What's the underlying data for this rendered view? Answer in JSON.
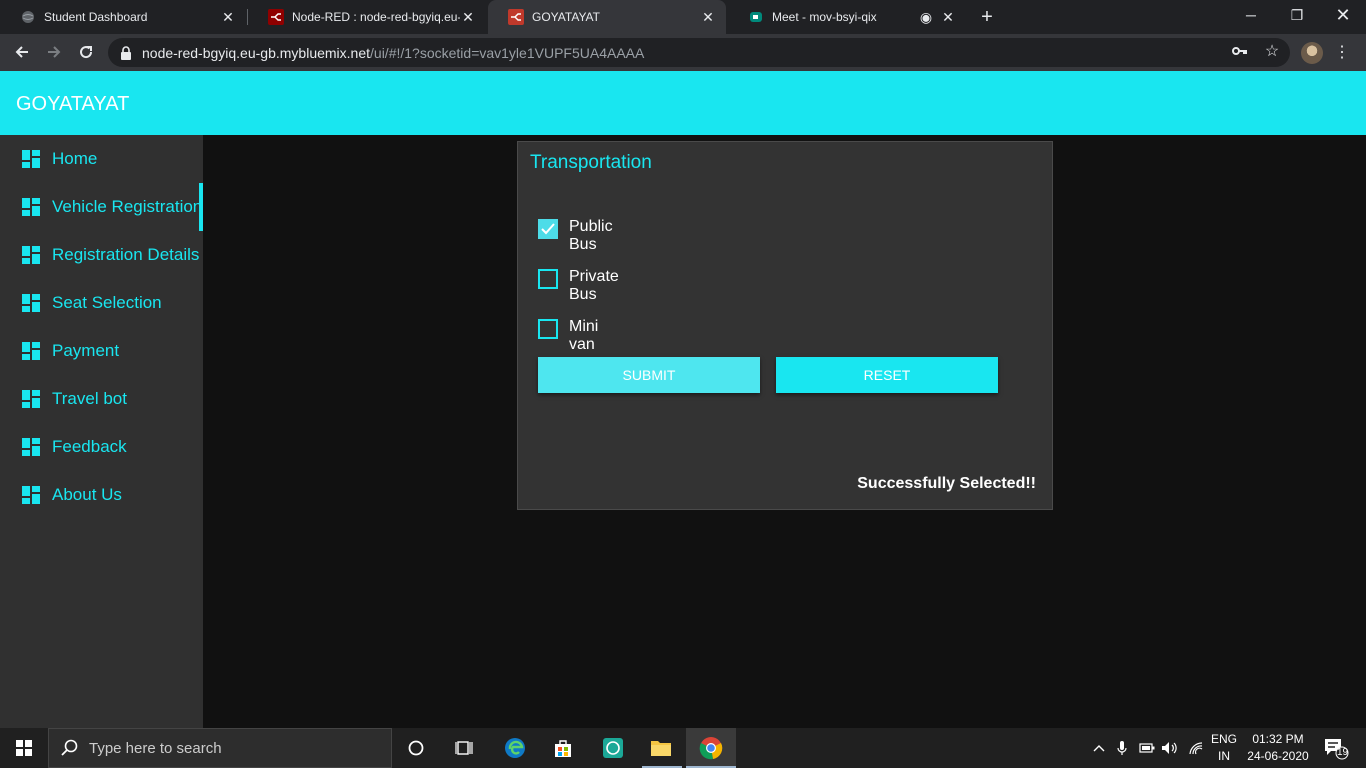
{
  "browser": {
    "tabs": [
      {
        "title": "Student Dashboard",
        "active": false
      },
      {
        "title": "Node-RED : node-red-bgyiq.eu-g",
        "active": false
      },
      {
        "title": "GOYATAYAT",
        "active": true
      },
      {
        "title": "Meet - mov-bsyi-qix",
        "active": false
      }
    ],
    "url_host": "node-red-bgyiq.eu-gb.mybluemix.net",
    "url_path": "/ui/#!/1?socketid=vav1yle1VUPF5UA4AAAA"
  },
  "app": {
    "title": "GOYATAYAT",
    "accent": "#19e6f0"
  },
  "sidebar": {
    "items": [
      {
        "label": "Home",
        "active": false
      },
      {
        "label": "Vehicle Registration",
        "active": true
      },
      {
        "label": "Registration Details",
        "active": false
      },
      {
        "label": "Seat Selection",
        "active": false
      },
      {
        "label": "Payment",
        "active": false
      },
      {
        "label": "Travel bot",
        "active": false
      },
      {
        "label": "Feedback",
        "active": false
      },
      {
        "label": "About Us",
        "active": false
      }
    ]
  },
  "card": {
    "title": "Transportation",
    "options": [
      {
        "line1": "Public",
        "line2": "Bus",
        "checked": true
      },
      {
        "line1": "Private",
        "line2": "Bus",
        "checked": false
      },
      {
        "line1": "Mini",
        "line2": "van",
        "checked": false
      }
    ],
    "submit_label": "SUBMIT",
    "reset_label": "RESET",
    "status": "Successfully Selected!!"
  },
  "taskbar": {
    "search_placeholder": "Type here to search",
    "lang_line1": "ENG",
    "lang_line2": "IN",
    "time": "01:32 PM",
    "date": "24-06-2020",
    "notification_count": "19"
  }
}
